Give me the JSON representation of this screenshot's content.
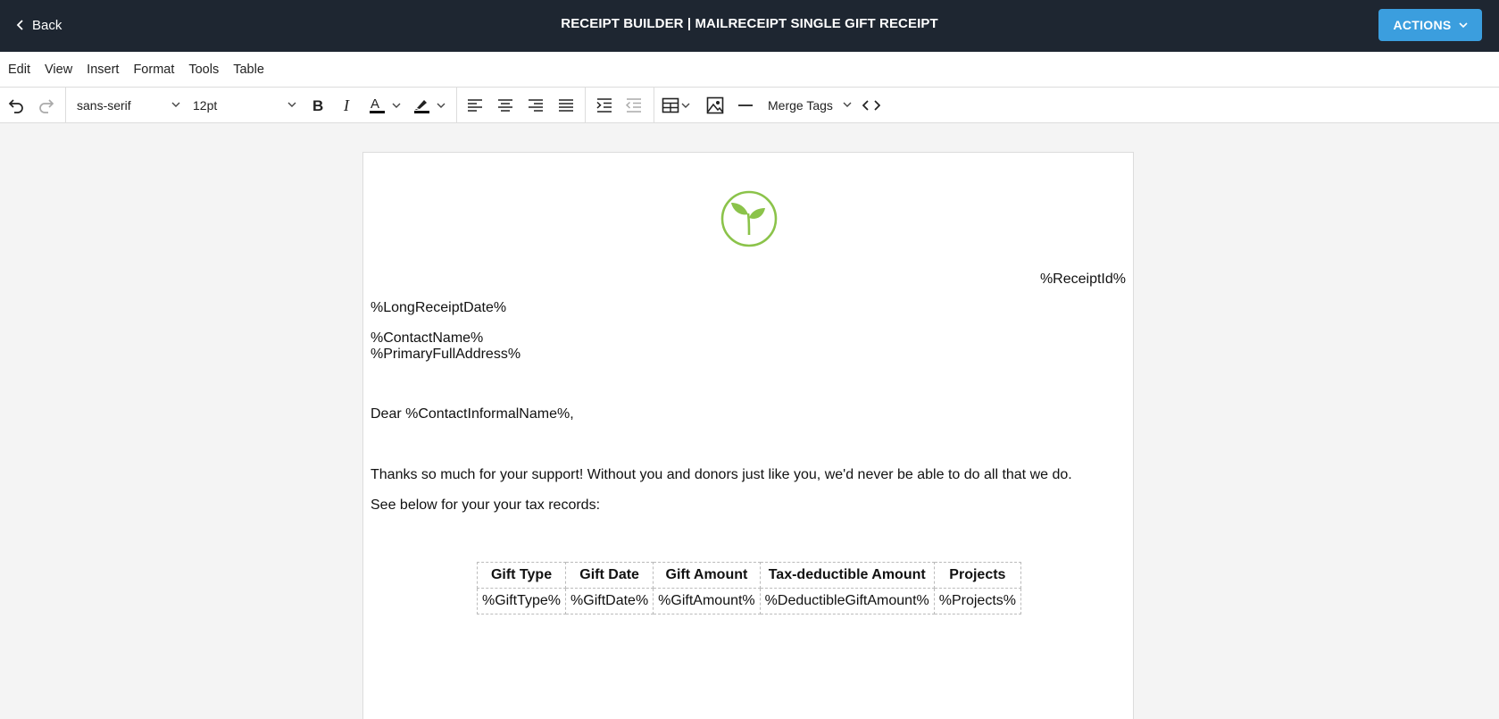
{
  "header": {
    "back_label": "Back",
    "title": "RECEIPT BUILDER | MAILRECEIPT SINGLE GIFT RECEIPT",
    "actions_label": "ACTIONS",
    "bg_color": "#1e2631",
    "accent_color": "#3b9ede"
  },
  "menubar": {
    "items": [
      {
        "label": "Edit"
      },
      {
        "label": "View"
      },
      {
        "label": "Insert"
      },
      {
        "label": "Format"
      },
      {
        "label": "Tools"
      },
      {
        "label": "Table"
      }
    ]
  },
  "toolbar": {
    "font_family": "sans-serif",
    "font_size": "12pt",
    "merge_tags_label": "Merge Tags",
    "icons": [
      "undo-icon",
      "redo-icon",
      "bold-icon",
      "italic-icon",
      "text-color-icon",
      "highlight-icon",
      "align-left-icon",
      "align-center-icon",
      "align-right-icon",
      "align-justify-icon",
      "indent-icon",
      "outdent-icon",
      "table-icon",
      "image-icon",
      "horizontal-rule-icon",
      "source-code-icon"
    ]
  },
  "document": {
    "logo_color": "#8bc34a",
    "receipt_id": "%ReceiptId%",
    "long_receipt_date": "%LongReceiptDate%",
    "contact_name": "%ContactName%",
    "primary_full_address": "%PrimaryFullAddress%",
    "greeting": "Dear %ContactInformalName%,",
    "body_1": "Thanks so much for your support! Without you and donors just like you, we'd never be able to do all that we do.",
    "body_2": "See below for your your tax records:",
    "table": {
      "headers": [
        "Gift Type",
        "Gift Date",
        "Gift Amount",
        "Tax-deductible Amount",
        "Projects"
      ],
      "row": [
        "%GiftType%",
        "%GiftDate%",
        "%GiftAmount%",
        "%DeductibleGiftAmount%",
        "%Projects%"
      ]
    }
  }
}
